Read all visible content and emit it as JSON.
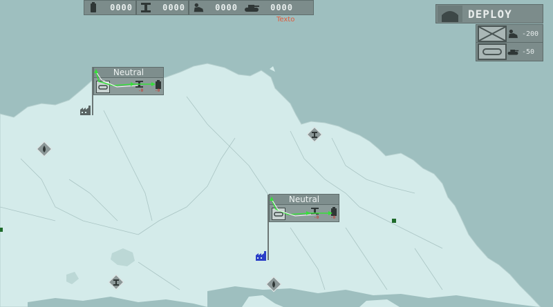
{
  "resources": {
    "fuel": "0000",
    "steel": "0000",
    "infantry": "0000",
    "tanks": "0000"
  },
  "notice_text": "Texto",
  "deploy": {
    "label": "DEPLOY"
  },
  "units": [
    {
      "name": "infantry",
      "cost": "-200"
    },
    {
      "name": "armor",
      "cost": "-50"
    }
  ],
  "cities": [
    {
      "owner": "Neutral",
      "neg1": "-0",
      "neg2": "-0"
    },
    {
      "owner": "Neutral",
      "neg1": "-0",
      "neg2": "-0"
    }
  ],
  "colors": {
    "sea": "#9ebfbf",
    "land": "#d4ebea",
    "panel": "#7c8c8b",
    "player_blue": "#2a3ec8",
    "route_green": "#36e03a"
  },
  "map_markers": [
    "oil-resource",
    "steel-resource",
    "oil-resource",
    "steel-resource",
    "factory-gray",
    "factory-blue"
  ]
}
